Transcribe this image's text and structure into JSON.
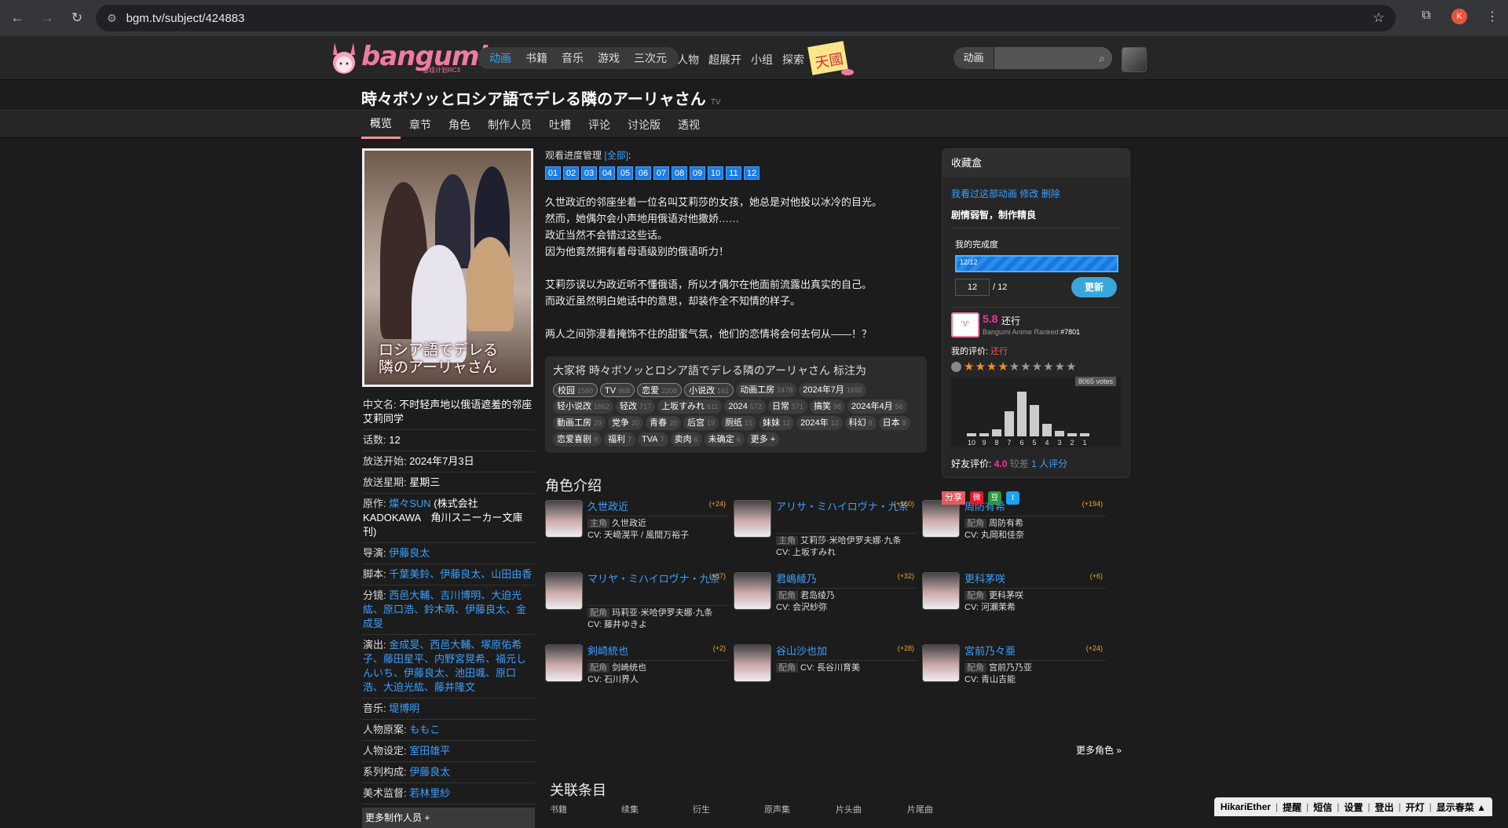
{
  "browser": {
    "url": "bgm.tv/subject/424883",
    "profile_initial": "K"
  },
  "site": {
    "logo_text": "bangumi",
    "logo_sub": "番组计划RC3",
    "categories": [
      "动画",
      "书籍",
      "音乐",
      "游戏",
      "三次元"
    ],
    "nav": [
      "人物",
      "超展开",
      "小组",
      "探索"
    ],
    "tengoku_text": "天國",
    "search_category": "动画"
  },
  "subject": {
    "title": "時々ボソッとロシア語でデレる隣のアーリャさん",
    "type": "TV",
    "tabs": [
      "概览",
      "章节",
      "角色",
      "制作人员",
      "吐槽",
      "评论",
      "讨论版",
      "透视"
    ],
    "poster_title": "ロシア語でデレる\n隣のアーリャさん"
  },
  "infobox": [
    {
      "k": "中文名: ",
      "v": "不时轻声地以俄语遮羞的邻座艾莉同学",
      "link": false
    },
    {
      "k": "话数: ",
      "v": "12",
      "link": false
    },
    {
      "k": "放送开始: ",
      "v": "2024年7月3日",
      "link": false
    },
    {
      "k": "放送星期: ",
      "v": "星期三",
      "link": false
    },
    {
      "k": "原作: ",
      "v": "燦々SUN",
      "extra": " (株式会社KADOKAWA　角川スニーカー文庫刊)",
      "link": true
    },
    {
      "k": "导演: ",
      "v": "伊藤良太",
      "link": true
    },
    {
      "k": "脚本: ",
      "v": "千葉美鈴、伊藤良太、山田由香",
      "link": true
    },
    {
      "k": "分镜: ",
      "v": "西邑大輔、吉川博明、大迫光紘、原口浩、鈴木萌、伊藤良太、金成旻",
      "link": true
    },
    {
      "k": "演出: ",
      "v": "金成旻、西邑大輔、塚原佑希子、藤田星平、内野宮晃希、福元しんいち、伊藤良太、池田颯、原口浩、大迫光紘、藤井隆文",
      "link": true
    },
    {
      "k": "音乐: ",
      "v": "堤博明",
      "link": true
    },
    {
      "k": "人物原案: ",
      "v": "ももこ",
      "link": true
    },
    {
      "k": "人物设定: ",
      "v": "室田雄平",
      "link": true
    },
    {
      "k": "系列构成: ",
      "v": "伊藤良太",
      "link": true
    },
    {
      "k": "美术监督: ",
      "v": "若林里紗",
      "link": true
    }
  ],
  "more_staff": "更多制作人员 +",
  "episodes": {
    "label": "观看进度管理",
    "all": "[全部]",
    "colon": ":",
    "list": [
      "01",
      "02",
      "03",
      "04",
      "05",
      "06",
      "07",
      "08",
      "09",
      "10",
      "11",
      "12"
    ]
  },
  "summary": [
    "久世政近的邻座坐着一位名叫艾莉莎的女孩，她总是对他投以冰冷的目光。",
    "然而，她偶尔会小声地用俄语对他撒娇……",
    "政近当然不会错过这些话。",
    "因为他竟然拥有着母语级别的俄语听力！",
    "",
    "艾莉莎误以为政近听不懂俄语，所以才偶尔在他面前流露出真实的自己。",
    "而政近虽然明白她话中的意思，却装作全不知情的样子。",
    "",
    "两人之间弥漫着掩饰不住的甜蜜气氛，他们的恋情将会何去何从——！？"
  ],
  "tags": {
    "header": "大家将 時々ボソッとロシア語でデレる隣のアーリャさん 标注为",
    "list": [
      {
        "name": "校园",
        "count": "1560",
        "mine": true
      },
      {
        "name": "TV",
        "count": "968",
        "mine": true
      },
      {
        "name": "恋爱",
        "count": "2208",
        "mine": true
      },
      {
        "name": "小说改",
        "count": "161",
        "mine": true
      },
      {
        "name": "动画工房",
        "count": "2478",
        "mine": false
      },
      {
        "name": "2024年7月",
        "count": "1692",
        "mine": false
      },
      {
        "name": "轻小说改",
        "count": "1662",
        "mine": false
      },
      {
        "name": "轻改",
        "count": "717",
        "mine": false
      },
      {
        "name": "上坂すみれ",
        "count": "611",
        "mine": false
      },
      {
        "name": "2024",
        "count": "572",
        "mine": false
      },
      {
        "name": "日常",
        "count": "571",
        "mine": false
      },
      {
        "name": "搞笑",
        "count": "98",
        "mine": false
      },
      {
        "name": "2024年4月",
        "count": "56",
        "mine": false
      },
      {
        "name": "動画工房",
        "count": "29",
        "mine": false
      },
      {
        "name": "党争",
        "count": "20",
        "mine": false
      },
      {
        "name": "青春",
        "count": "20",
        "mine": false
      },
      {
        "name": "后宫",
        "count": "19",
        "mine": false
      },
      {
        "name": "厕纸",
        "count": "15",
        "mine": false
      },
      {
        "name": "妹妹",
        "count": "12",
        "mine": false
      },
      {
        "name": "2024年",
        "count": "12",
        "mine": false
      },
      {
        "name": "科幻",
        "count": "8",
        "mine": false
      },
      {
        "name": "日本",
        "count": "8",
        "mine": false
      },
      {
        "name": "恋爱喜剧",
        "count": "8",
        "mine": false
      },
      {
        "name": "福利",
        "count": "7",
        "mine": false
      },
      {
        "name": "TVA",
        "count": "7",
        "mine": false
      },
      {
        "name": "卖肉",
        "count": "6",
        "mine": false
      },
      {
        "name": "未确定",
        "count": "6",
        "mine": false
      },
      {
        "name": "更多 +",
        "count": "",
        "mine": false
      }
    ]
  },
  "characters": {
    "title": "角色介绍",
    "list": [
      {
        "name": "久世政近",
        "comments": "(+24)",
        "role": "主角",
        "cn": "久世政近",
        "cv": "CV: 天﨑滉平 / 風間万裕子"
      },
      {
        "name": "アリサ・ミハイロヴナ・九条",
        "comments": "(+160)",
        "role": "主角",
        "cn": "艾莉莎·米哈伊罗夫娜·九条",
        "cv": "CV: 上坂すみれ"
      },
      {
        "name": "周防有希",
        "comments": "(+194)",
        "role": "配角",
        "cn": "周防有希",
        "cv": "CV: 丸岡和佳奈"
      },
      {
        "name": "マリヤ・ミハイロヴナ・九条",
        "comments": "(+37)",
        "role": "配角",
        "cn": "玛莉亚·米哈伊罗夫娜·九条",
        "cv": "CV: 藤井ゆきよ"
      },
      {
        "name": "君嶋綾乃",
        "comments": "(+32)",
        "role": "配角",
        "cn": "君岛绫乃",
        "cv": "CV: 会沢紗弥"
      },
      {
        "name": "更科茅咲",
        "comments": "(+6)",
        "role": "配角",
        "cn": "更科茅咲",
        "cv": "CV: 河瀬茉希"
      },
      {
        "name": "剣崎統也",
        "comments": "(+2)",
        "role": "配角",
        "cn": "剑崎统也",
        "cv": "CV: 石川界人"
      },
      {
        "name": "谷山沙也加",
        "comments": "(+28)",
        "role": "配角",
        "cn": "CV: 長谷川育美",
        "cv": ""
      },
      {
        "name": "宮前乃々亜",
        "comments": "(+24)",
        "role": "配角",
        "cn": "宫前乃乃亚",
        "cv": "CV: 青山吉能"
      }
    ],
    "more": "更多角色 »"
  },
  "related": {
    "title": "关联条目",
    "cats": [
      "书籍",
      "续集",
      "衍生",
      "原声集",
      "片头曲",
      "片尾曲"
    ]
  },
  "collect": {
    "header": "收藏盒",
    "watched": "我看过这部动画",
    "edit": "修改",
    "delete": "删除",
    "comment": "剧情弱智，制作精良",
    "progress_label": "我的完成度",
    "progress_text": "12/12",
    "progress_fraction": 1.0,
    "ep_input": "12",
    "ep_total": "/ 12",
    "update": "更新",
    "score": "5.8",
    "score_label": "还行",
    "rank_text": "Bangumi Anime Ranked:",
    "rank": "#7801",
    "myrating_label": "我的评价:",
    "myrating_value": "还行",
    "my_stars": 4,
    "votes": "8065 votes",
    "histogram": {
      "labels": [
        "10",
        "9",
        "8",
        "7",
        "6",
        "5",
        "4",
        "3",
        "2",
        "1"
      ],
      "values": [
        0.05,
        0.05,
        0.13,
        0.46,
        0.82,
        0.57,
        0.23,
        0.1,
        0.05,
        0.05
      ]
    },
    "friend_label": "好友评价:",
    "friend_score": "4.0",
    "friend_dim": "较差",
    "friend_count": "1 人评分"
  },
  "share": {
    "label": "分享"
  },
  "dock": [
    "HikariEther",
    "提醒",
    "短信",
    "设置",
    "登出",
    "开灯",
    "显示春菜 ▲"
  ],
  "colors": {
    "accent": "#3aa0ff",
    "pink": "#f07aa3",
    "episode": "#1c7ce0"
  }
}
